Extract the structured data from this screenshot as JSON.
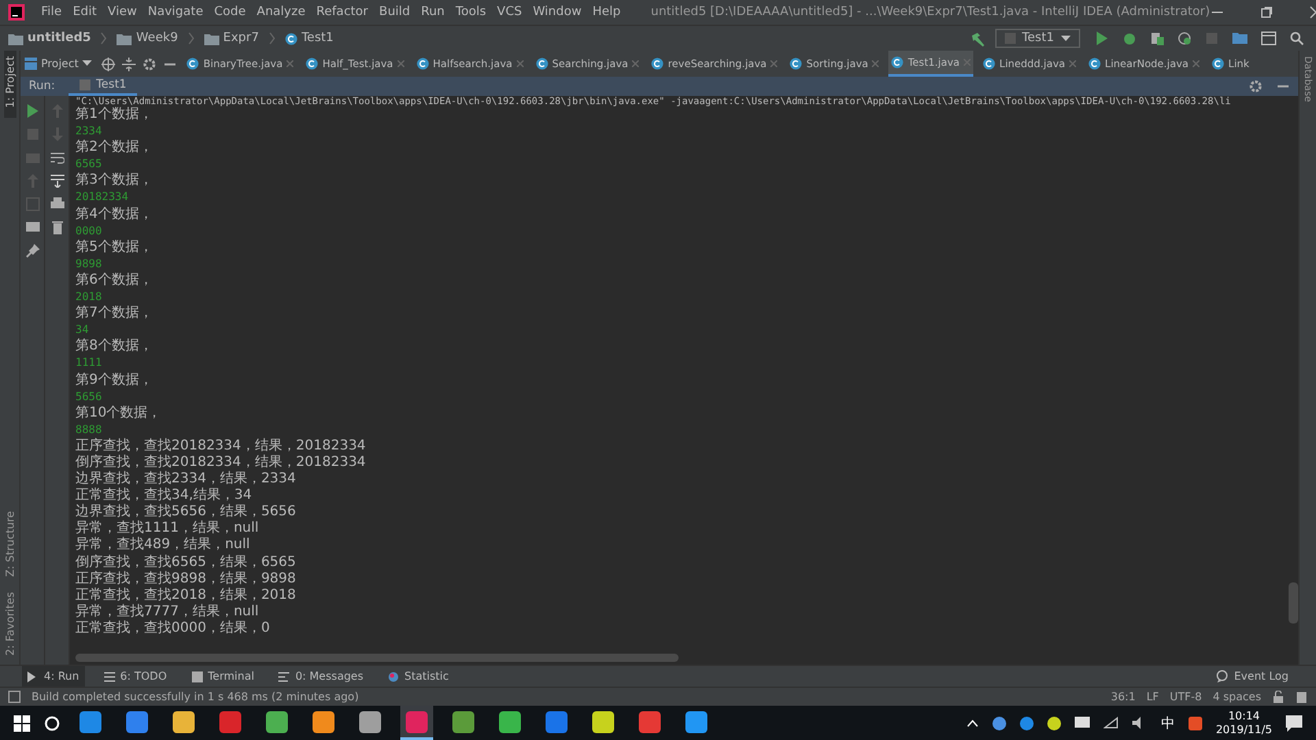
{
  "menu": [
    "File",
    "Edit",
    "View",
    "Navigate",
    "Code",
    "Analyze",
    "Refactor",
    "Build",
    "Run",
    "Tools",
    "VCS",
    "Window",
    "Help"
  ],
  "window": {
    "title": "untitled5 [D:\\IDEAAAA\\untitled5] - ...\\Week9\\Expr7\\Test1.java - IntelliJ IDEA (Administrator)"
  },
  "breadcrumbs": [
    {
      "label": "untitled5",
      "kind": "project"
    },
    {
      "label": "Week9",
      "kind": "folder"
    },
    {
      "label": "Expr7",
      "kind": "package"
    },
    {
      "label": "Test1",
      "kind": "class"
    }
  ],
  "run_config": {
    "label": "Test1"
  },
  "project_view": {
    "label": "Project"
  },
  "editor_tabs": [
    {
      "label": "BinaryTree.java",
      "selected": false
    },
    {
      "label": "Half_Test.java",
      "selected": false
    },
    {
      "label": "Halfsearch.java",
      "selected": false
    },
    {
      "label": "Searching.java",
      "selected": false
    },
    {
      "label": "reveSearching.java",
      "selected": false
    },
    {
      "label": "Sorting.java",
      "selected": false
    },
    {
      "label": "Test1.java",
      "selected": true
    },
    {
      "label": "Lineddd.java",
      "selected": false
    },
    {
      "label": "LinearNode.java",
      "selected": false
    },
    {
      "label": "Link",
      "selected": false
    }
  ],
  "left_strip": {
    "top": "1: Project",
    "bottom": [
      "Z: Structure",
      "2: Favorites"
    ]
  },
  "right_strip": {
    "label": "Database"
  },
  "run_panel": {
    "title": "Run:",
    "tab": "Test1"
  },
  "console": {
    "command": "\"C:\\Users\\Administrator\\AppData\\Local\\JetBrains\\Toolbox\\apps\\IDEA-U\\ch-0\\192.6603.28\\jbr\\bin\\java.exe\" -javaagent:C:\\Users\\Administrator\\AppData\\Local\\JetBrains\\Toolbox\\apps\\IDEA-U\\ch-0\\192.6603.28\\li",
    "lines": [
      {
        "kind": "prompt",
        "text": "第1个数据，"
      },
      {
        "kind": "input",
        "text": "2334"
      },
      {
        "kind": "prompt",
        "text": "第2个数据，"
      },
      {
        "kind": "input",
        "text": "6565"
      },
      {
        "kind": "prompt",
        "text": "第3个数据，"
      },
      {
        "kind": "input",
        "text": "20182334"
      },
      {
        "kind": "prompt",
        "text": "第4个数据，"
      },
      {
        "kind": "input",
        "text": "0000"
      },
      {
        "kind": "prompt",
        "text": "第5个数据，"
      },
      {
        "kind": "input",
        "text": "9898"
      },
      {
        "kind": "prompt",
        "text": "第6个数据，"
      },
      {
        "kind": "input",
        "text": "2018"
      },
      {
        "kind": "prompt",
        "text": "第7个数据，"
      },
      {
        "kind": "input",
        "text": "34"
      },
      {
        "kind": "prompt",
        "text": "第8个数据，"
      },
      {
        "kind": "input",
        "text": "1111"
      },
      {
        "kind": "prompt",
        "text": "第9个数据，"
      },
      {
        "kind": "input",
        "text": "5656"
      },
      {
        "kind": "prompt",
        "text": "第10个数据，"
      },
      {
        "kind": "input",
        "text": "8888"
      },
      {
        "kind": "output",
        "text": "正序查找，查找20182334，结果，20182334"
      },
      {
        "kind": "output",
        "text": "倒序查找，查找20182334，结果，20182334"
      },
      {
        "kind": "output",
        "text": "边界查找，查找2334，结果，2334"
      },
      {
        "kind": "output",
        "text": "正常查找，查找34,结果，34"
      },
      {
        "kind": "output",
        "text": "边界查找，查找5656，结果，5656"
      },
      {
        "kind": "output",
        "text": "异常，查找1111，结果，null"
      },
      {
        "kind": "output",
        "text": "异常，查找489，结果，null"
      },
      {
        "kind": "output",
        "text": "倒序查找，查找6565，结果，6565"
      },
      {
        "kind": "output",
        "text": "正序查找，查找9898，结果，9898"
      },
      {
        "kind": "output",
        "text": "正常查找，查找2018，结果，2018"
      },
      {
        "kind": "output",
        "text": "异常，查找7777，结果，null"
      },
      {
        "kind": "output",
        "text": "正常查找，查找0000，结果，0"
      }
    ]
  },
  "tool_windows": [
    {
      "label": "4: Run",
      "selected": true
    },
    {
      "label": "6: TODO",
      "selected": false
    },
    {
      "label": "Terminal",
      "selected": false
    },
    {
      "label": "0: Messages",
      "selected": false
    },
    {
      "label": "Statistic",
      "selected": false
    }
  ],
  "event_log": {
    "label": "Event Log"
  },
  "status_bar": {
    "message": "Build completed successfully in 1 s 468 ms (2 minutes ago)",
    "items": [
      "36:1",
      "LF",
      "UTF-8",
      "4 spaces"
    ]
  },
  "taskbar": {
    "apps": [
      {
        "color": "#1e88e5",
        "selected": false
      },
      {
        "color": "#2f80ed",
        "selected": false
      },
      {
        "color": "#e8b339",
        "selected": false
      },
      {
        "color": "#d9252a",
        "selected": false
      },
      {
        "color": "#4caf50",
        "selected": false
      },
      {
        "color": "#f08a1c",
        "selected": false
      },
      {
        "color": "#9e9e9e",
        "selected": false
      },
      {
        "color": "#e0245e",
        "selected": true
      },
      {
        "color": "#5b9b3a",
        "selected": false
      },
      {
        "color": "#39b54a",
        "selected": false
      },
      {
        "color": "#1a73e8",
        "selected": false
      },
      {
        "color": "#c7d21d",
        "selected": false
      },
      {
        "color": "#e53935",
        "selected": false
      },
      {
        "color": "#2196f3",
        "selected": false
      }
    ],
    "ime": "中",
    "time": "10:14",
    "date": "2019/11/5"
  }
}
